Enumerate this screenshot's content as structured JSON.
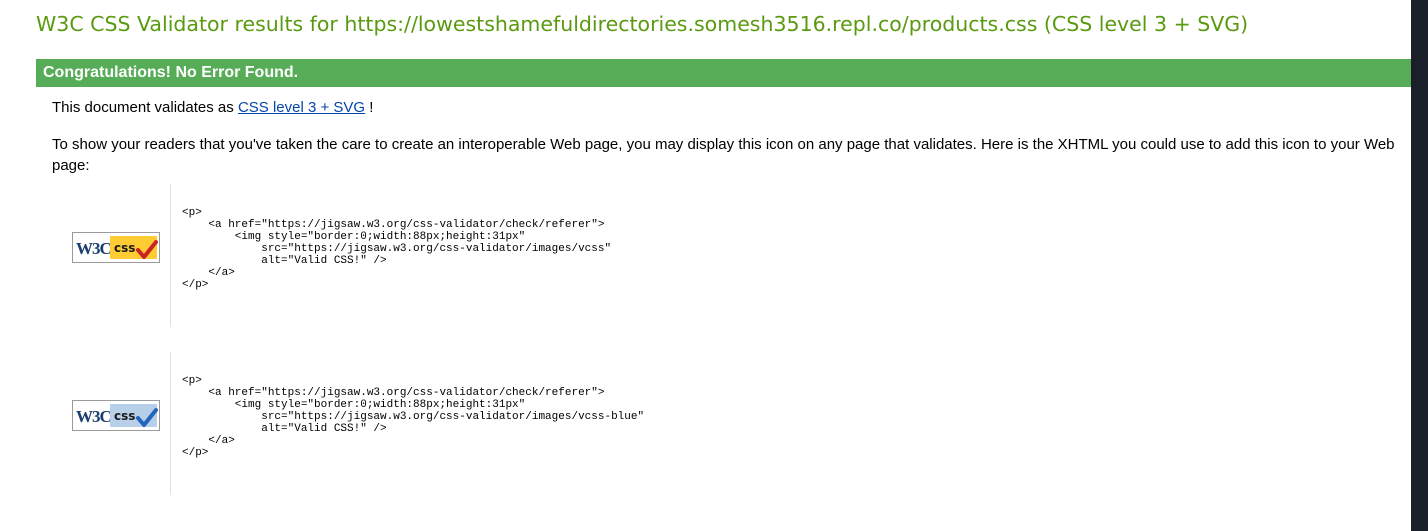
{
  "heading": "W3C CSS Validator results for https://lowestshamefuldirectories.somesh3516.repl.co/products.css (CSS level 3 + SVG)",
  "congrats": "Congratulations! No Error Found.",
  "validates": {
    "prefix": "This document validates as ",
    "link": "CSS level 3 + SVG",
    "suffix": " !"
  },
  "info": "To show your readers that you've taken the care to create an interoperable Web page, you may display this icon on any page that validates. Here is the XHTML you could use to add this icon to your Web page:",
  "badges": [
    {
      "name": "vcss-gold",
      "w3c_text": "W3C",
      "css_text": "css",
      "css_bg": "#ffcc33",
      "check_color": "#cc2222",
      "code": "<p>\n    <a href=\"https://jigsaw.w3.org/css-validator/check/referer\">\n        <img style=\"border:0;width:88px;height:31px\"\n            src=\"https://jigsaw.w3.org/css-validator/images/vcss\"\n            alt=\"Valid CSS!\" />\n    </a>\n</p>"
    },
    {
      "name": "vcss-blue",
      "w3c_text": "W3C",
      "css_text": "css",
      "css_bg": "#b7cfe8",
      "check_color": "#2266bb",
      "code": "<p>\n    <a href=\"https://jigsaw.w3.org/css-validator/check/referer\">\n        <img style=\"border:0;width:88px;height:31px\"\n            src=\"https://jigsaw.w3.org/css-validator/images/vcss-blue\"\n            alt=\"Valid CSS!\" />\n    </a>\n</p>"
    }
  ]
}
